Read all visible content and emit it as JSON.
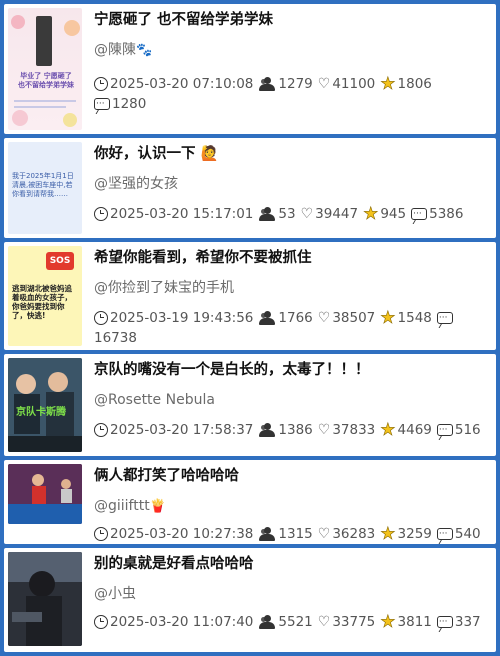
{
  "posts": [
    {
      "title": "宁愿砸了 也不留给学弟学妹",
      "author": "@陳陳",
      "author_emoji": "🐾",
      "date": "2025-03-20 07:10:08",
      "views": "1279",
      "likes": "41100",
      "stars": "1806",
      "comments": "1280",
      "thumb_text": "毕业了 宁愿砸了 也不留给学弟学妹"
    },
    {
      "title": "你好，认识一下 🙋",
      "author": "@坚强的女孩",
      "author_emoji": "",
      "date": "2025-03-20 15:17:01",
      "views": "53",
      "likes": "39447",
      "stars": "945",
      "comments": "5386",
      "thumb_text": "我于2025年1月1日清晨,被困车座中,若你看到请帮我……"
    },
    {
      "title": "希望你能看到，希望你不要被抓住",
      "author": "@你捡到了妹宝的手机",
      "author_emoji": "",
      "date": "2025-03-19 19:43:56",
      "views": "1766",
      "likes": "38507",
      "stars": "1548",
      "comments": "16738",
      "thumb_text": "逃到湖北被爸妈追着吸血的女孩子，你爸妈要找到你了，快逃!",
      "thumb_badge": "SOS"
    },
    {
      "title": "京队的嘴没有一个是白长的，太毒了！！！",
      "author": "@Rosette Nebula",
      "author_emoji": "",
      "date": "2025-03-20 17:58:37",
      "views": "1386",
      "likes": "37833",
      "stars": "4469",
      "comments": "516",
      "thumb_text": "京队卡斯腾"
    },
    {
      "title": "俩人都打笑了哈哈哈哈",
      "author": "@giiifttt",
      "author_emoji": "🍟",
      "date": "2025-03-20 10:27:38",
      "views": "1315",
      "likes": "36283",
      "stars": "3259",
      "comments": "540",
      "thumb_text": ""
    },
    {
      "title": "别的桌就是好看点哈哈哈",
      "author": "@小虫",
      "author_emoji": "",
      "date": "2025-03-20 11:07:40",
      "views": "5521",
      "likes": "33775",
      "stars": "3811",
      "comments": "337",
      "thumb_text": ""
    }
  ]
}
